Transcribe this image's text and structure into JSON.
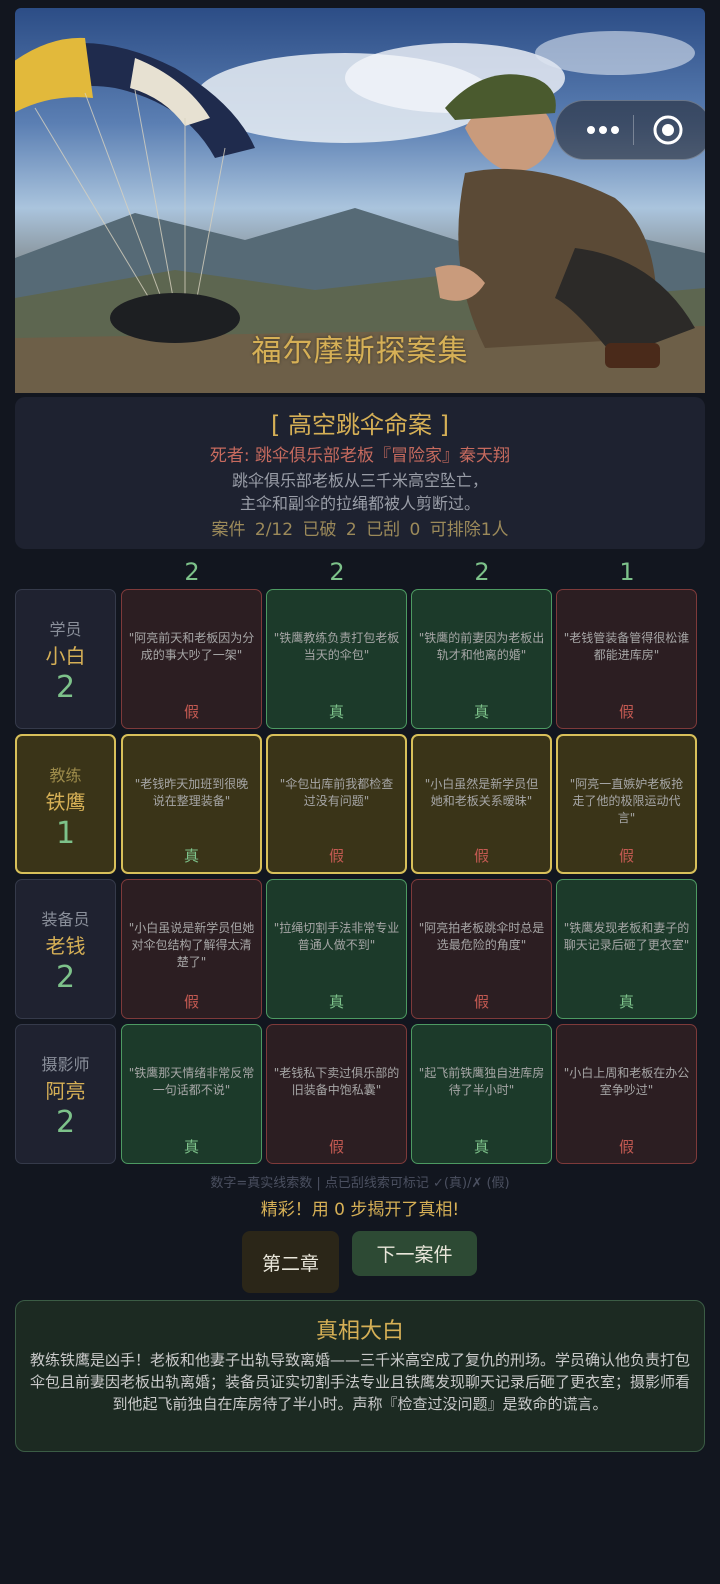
{
  "banner": {
    "title": "福尔摩斯探案集"
  },
  "case": {
    "title": "[ 高空跳伞命案 ]",
    "victim": "死者: 跳伞俱乐部老板『冒险家』秦天翔",
    "description_line1": "跳伞俱乐部老板从三千米高空坠亡，",
    "description_line2": "主伞和副伞的拉绳都被人剪断过。",
    "stats": "案件 2/12  已破 2  已刮 0  可排除1人"
  },
  "column_counts": [
    "2",
    "2",
    "2",
    "1"
  ],
  "rows": [
    {
      "role": "学员",
      "name": "小白",
      "count": "2",
      "cells": [
        {
          "clue": "\"阿亮前天和老板因为分成的事大吵了一架\"",
          "verdict": "假"
        },
        {
          "clue": "\"铁鹰教练负责打包老板当天的伞包\"",
          "verdict": "真"
        },
        {
          "clue": "\"铁鹰的前妻因为老板出轨才和他离的婚\"",
          "verdict": "真"
        },
        {
          "clue": "\"老钱管装备管得很松谁都能进库房\"",
          "verdict": "假"
        }
      ]
    },
    {
      "role": "教练",
      "name": "铁鹰",
      "count": "1",
      "cells": [
        {
          "clue": "\"老钱昨天加班到很晚说在整理装备\"",
          "verdict": "真"
        },
        {
          "clue": "\"伞包出库前我都检查过没有问题\"",
          "verdict": "假"
        },
        {
          "clue": "\"小白虽然是新学员但她和老板关系暧昧\"",
          "verdict": "假"
        },
        {
          "clue": "\"阿亮一直嫉妒老板抢走了他的极限运动代言\"",
          "verdict": "假"
        }
      ]
    },
    {
      "role": "装备员",
      "name": "老钱",
      "count": "2",
      "cells": [
        {
          "clue": "\"小白虽说是新学员但她对伞包结构了解得太清楚了\"",
          "verdict": "假"
        },
        {
          "clue": "\"拉绳切割手法非常专业普通人做不到\"",
          "verdict": "真"
        },
        {
          "clue": "\"阿亮拍老板跳伞时总是选最危险的角度\"",
          "verdict": "假"
        },
        {
          "clue": "\"铁鹰发现老板和妻子的聊天记录后砸了更衣室\"",
          "verdict": "真"
        }
      ]
    },
    {
      "role": "摄影师",
      "name": "阿亮",
      "count": "2",
      "cells": [
        {
          "clue": "\"铁鹰那天情绪非常反常一句话都不说\"",
          "verdict": "真"
        },
        {
          "clue": "\"老钱私下卖过俱乐部的旧装备中饱私囊\"",
          "verdict": "假"
        },
        {
          "clue": "\"起飞前铁鹰独自进库房待了半小时\"",
          "verdict": "真"
        },
        {
          "clue": "\"小白上周和老板在办公室争吵过\"",
          "verdict": "假"
        }
      ]
    }
  ],
  "legend": "数字=真实线索数 | 点已刮线索可标记 ✓(真)/✗ (假)",
  "success_message": "精彩！用 0 步揭开了真相!",
  "buttons": {
    "chapter": "第二章",
    "next_case": "下一案件"
  },
  "truth": {
    "title": "真相大白",
    "text": "教练铁鹰是凶手！老板和他妻子出轨导致离婚——三千米高空成了复仇的刑场。学员确认他负责打包伞包且前妻因老板出轨离婚；装备员证实切割手法专业且铁鹰发现聊天记录后砸了更衣室；摄影师看到他起飞前独自在库房待了半小时。声称『检查过没问题』是致命的谎言。"
  },
  "colors": {
    "accent_gold": "#d6b056",
    "true_green": "#7dc28a",
    "false_red": "#c45a52",
    "background": "#12161f"
  }
}
